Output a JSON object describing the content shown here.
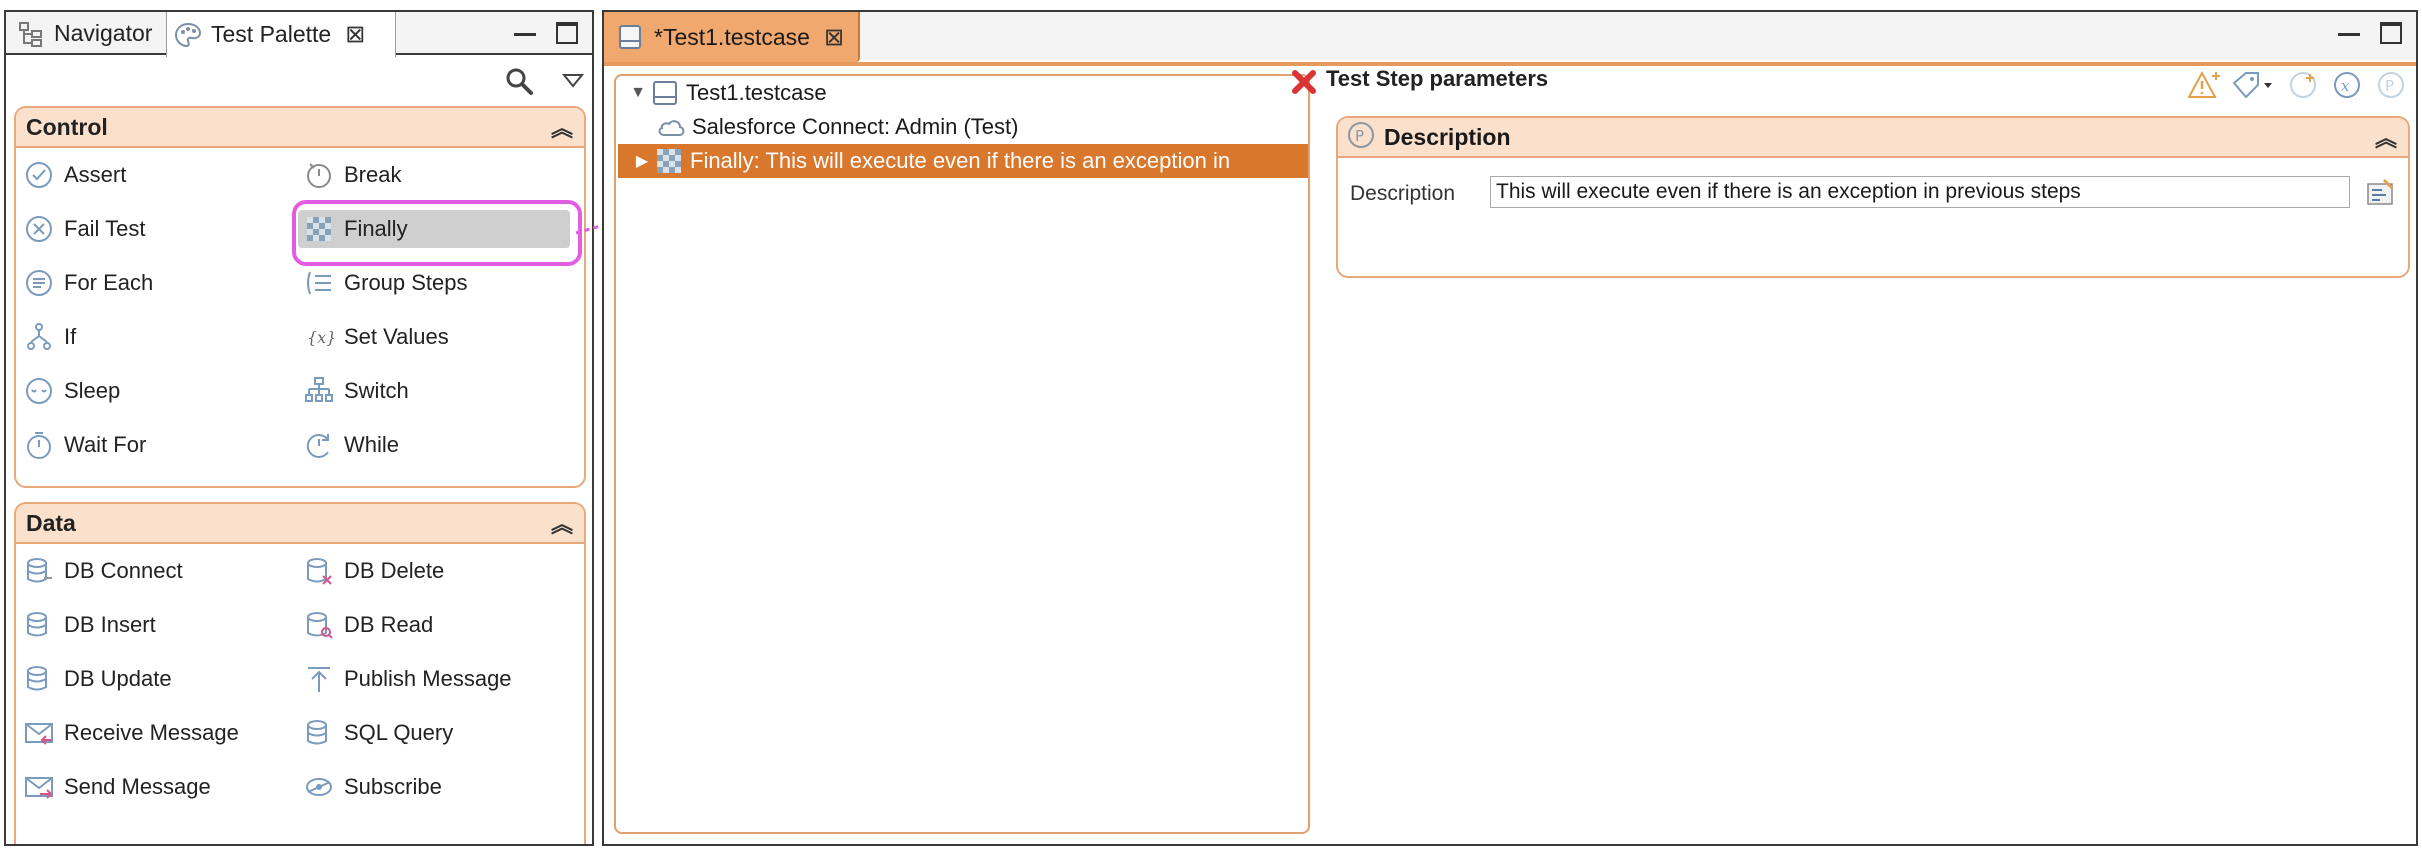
{
  "left_view": {
    "tabs": [
      {
        "label": "Navigator",
        "icon": "navigator-icon",
        "active": false
      },
      {
        "label": "Test Palette",
        "icon": "palette-icon",
        "active": true
      }
    ]
  },
  "palette": {
    "drawers": [
      {
        "title": "Control",
        "items": [
          {
            "label": "Assert",
            "icon": "assert-icon"
          },
          {
            "label": "Break",
            "icon": "break-icon"
          },
          {
            "label": "Fail Test",
            "icon": "fail-test-icon"
          },
          {
            "label": "Finally",
            "icon": "finally-icon",
            "selected": true
          },
          {
            "label": "For Each",
            "icon": "for-each-icon"
          },
          {
            "label": "Group Steps",
            "icon": "group-steps-icon"
          },
          {
            "label": "If",
            "icon": "if-icon"
          },
          {
            "label": "Set Values",
            "icon": "set-values-icon"
          },
          {
            "label": "Sleep",
            "icon": "sleep-icon"
          },
          {
            "label": "Switch",
            "icon": "switch-icon"
          },
          {
            "label": "Wait For",
            "icon": "wait-for-icon"
          },
          {
            "label": "While",
            "icon": "while-icon"
          }
        ]
      },
      {
        "title": "Data",
        "items": [
          {
            "label": "DB Connect",
            "icon": "db-connect-icon"
          },
          {
            "label": "DB Delete",
            "icon": "db-delete-icon"
          },
          {
            "label": "DB Insert",
            "icon": "db-insert-icon"
          },
          {
            "label": "DB Read",
            "icon": "db-read-icon"
          },
          {
            "label": "DB Update",
            "icon": "db-update-icon"
          },
          {
            "label": "Publish Message",
            "icon": "publish-message-icon"
          },
          {
            "label": "Receive Message",
            "icon": "receive-message-icon"
          },
          {
            "label": "SQL Query",
            "icon": "sql-query-icon"
          },
          {
            "label": "Send Message",
            "icon": "send-message-icon"
          },
          {
            "label": "Subscribe",
            "icon": "subscribe-icon"
          }
        ]
      }
    ]
  },
  "editor": {
    "tab_label": "*Test1.testcase",
    "tree": [
      {
        "label": "Test1.testcase",
        "icon": "testcase-icon",
        "expanded": true
      },
      {
        "label": "Salesforce Connect: Admin (Test)",
        "icon": "cloud-icon"
      },
      {
        "label": "Finally: This will execute even if there is an exception in",
        "icon": "finally-icon",
        "selected": true
      }
    ],
    "params_header": "Test Step parameters",
    "description_section": {
      "title": "Description",
      "field_label": "Description",
      "field_value": "This will execute even if there is an exception in previous steps"
    }
  },
  "colors": {
    "accent": "#e69a5c",
    "drawer_header": "#fbe1cc",
    "selection": "#d9772d",
    "highlight": "#e35de3"
  }
}
